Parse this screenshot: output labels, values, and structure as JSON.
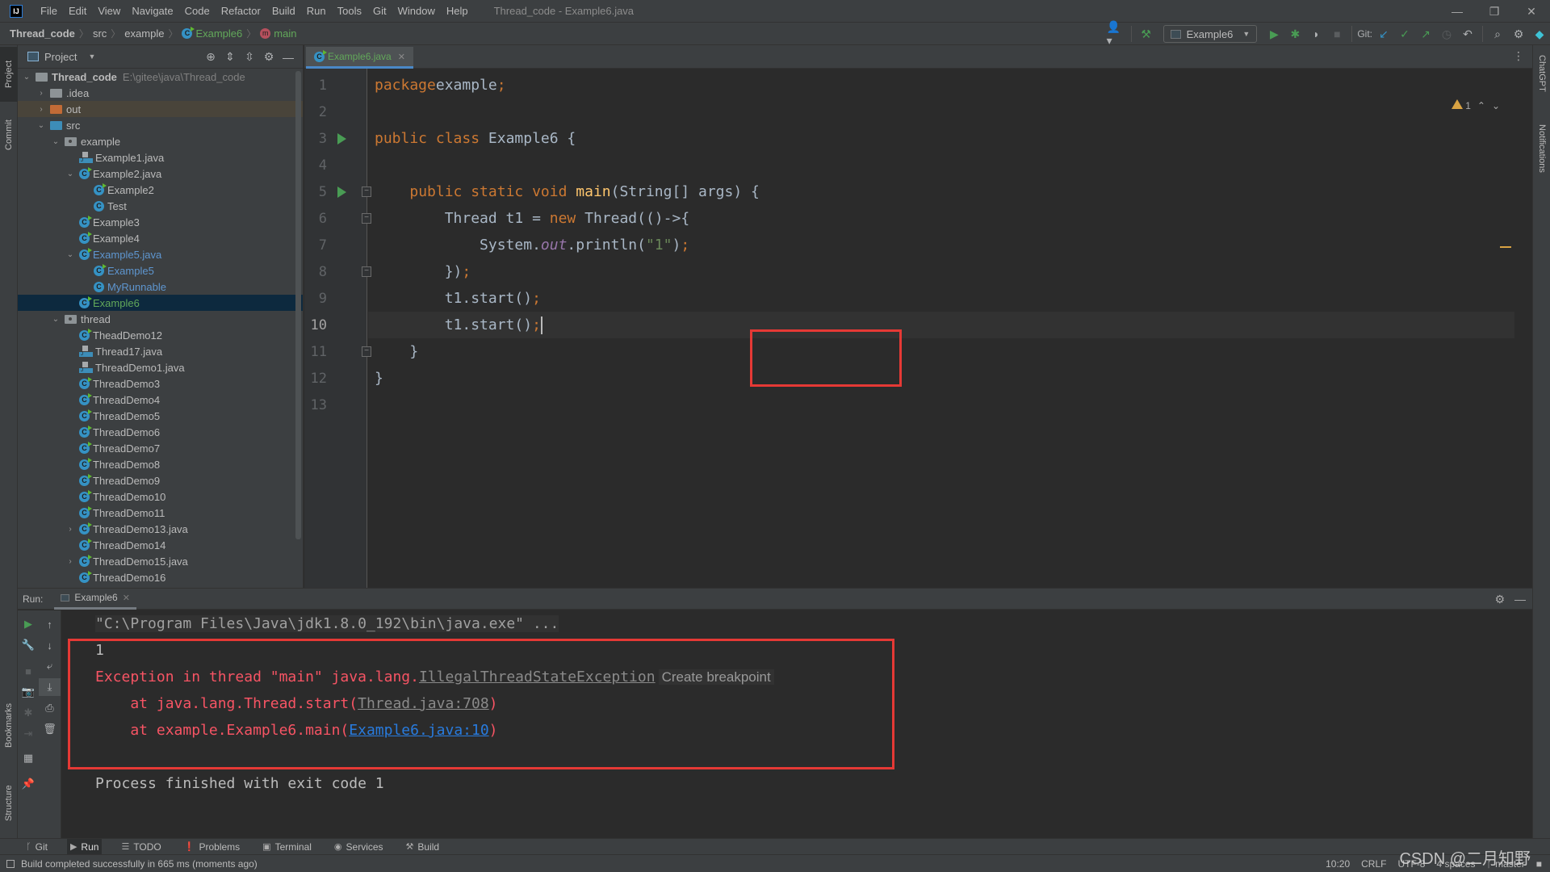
{
  "window": {
    "title": "Thread_code - Example6.java",
    "logo": "IJ",
    "controls": [
      "minimize",
      "restore",
      "close"
    ]
  },
  "menu": [
    "File",
    "Edit",
    "View",
    "Navigate",
    "Code",
    "Refactor",
    "Build",
    "Run",
    "Tools",
    "Git",
    "Window",
    "Help"
  ],
  "breadcrumb": [
    "Thread_code",
    "src",
    "example",
    "Example6",
    "main"
  ],
  "toolbar": {
    "run_config": "Example6",
    "git_label": "Git:"
  },
  "left_stripe": {
    "project": "Project",
    "commit": "Commit",
    "bookmarks": "Bookmarks",
    "structure": "Structure"
  },
  "right_stripe": {
    "chatgpt": "ChatGPT",
    "notifications": "Notifications"
  },
  "project": {
    "title": "Project",
    "root_name": "Thread_code",
    "root_path": "E:\\gitee\\java\\Thread_code",
    "tree": [
      {
        "label": ".idea",
        "kind": "folder",
        "depth": 1,
        "arrow": "right"
      },
      {
        "label": "out",
        "kind": "folder-orange",
        "depth": 1,
        "arrow": "right"
      },
      {
        "label": "src",
        "kind": "folder-blue",
        "depth": 1,
        "arrow": "down"
      },
      {
        "label": "example",
        "kind": "package",
        "depth": 2,
        "arrow": "down"
      },
      {
        "label": "Example1.java",
        "kind": "java-file",
        "depth": 3
      },
      {
        "label": "Example2.java",
        "kind": "class-run",
        "depth": 3,
        "arrow": "down"
      },
      {
        "label": "Example2",
        "kind": "class-run",
        "depth": 4
      },
      {
        "label": "Test",
        "kind": "class",
        "depth": 4
      },
      {
        "label": "Example3",
        "kind": "class-run",
        "depth": 3
      },
      {
        "label": "Example4",
        "kind": "class-run",
        "depth": 3
      },
      {
        "label": "Example5.java",
        "kind": "class-run",
        "depth": 3,
        "arrow": "down",
        "color": "blue"
      },
      {
        "label": "Example5",
        "kind": "class-run",
        "depth": 4,
        "color": "blue"
      },
      {
        "label": "MyRunnable",
        "kind": "class",
        "depth": 4,
        "color": "blue"
      },
      {
        "label": "Example6",
        "kind": "class-run",
        "depth": 3,
        "color": "green",
        "selected": true
      },
      {
        "label": "thread",
        "kind": "package",
        "depth": 2,
        "arrow": "down"
      },
      {
        "label": "TheadDemo12",
        "kind": "class-run",
        "depth": 3
      },
      {
        "label": "Thread17.java",
        "kind": "java-file",
        "depth": 3
      },
      {
        "label": "ThreadDemo1.java",
        "kind": "java-file",
        "depth": 3
      },
      {
        "label": "ThreadDemo3",
        "kind": "class-run",
        "depth": 3
      },
      {
        "label": "ThreadDemo4",
        "kind": "class-run",
        "depth": 3
      },
      {
        "label": "ThreadDemo5",
        "kind": "class-run",
        "depth": 3
      },
      {
        "label": "ThreadDemo6",
        "kind": "class-run",
        "depth": 3
      },
      {
        "label": "ThreadDemo7",
        "kind": "class-run",
        "depth": 3
      },
      {
        "label": "ThreadDemo8",
        "kind": "class-run",
        "depth": 3
      },
      {
        "label": "ThreadDemo9",
        "kind": "class-run",
        "depth": 3
      },
      {
        "label": "ThreadDemo10",
        "kind": "class-run",
        "depth": 3
      },
      {
        "label": "ThreadDemo11",
        "kind": "class-run",
        "depth": 3
      },
      {
        "label": "ThreadDemo13.java",
        "kind": "class-run",
        "depth": 3,
        "arrow": "right"
      },
      {
        "label": "ThreadDemo14",
        "kind": "class-run",
        "depth": 3
      },
      {
        "label": "ThreadDemo15.java",
        "kind": "class-run",
        "depth": 3,
        "arrow": "right"
      },
      {
        "label": "ThreadDemo16",
        "kind": "class-run",
        "depth": 3
      }
    ]
  },
  "editor": {
    "tab": "Example6.java",
    "warnings": "1",
    "current_line": 10,
    "lines": [
      {
        "n": "1",
        "tokens": [
          [
            "kw",
            "package"
          ],
          [
            "",
            "example"
          ],
          [
            "kw",
            ";"
          ]
        ]
      },
      {
        "n": "2",
        "tokens": []
      },
      {
        "n": "3",
        "run": true,
        "tokens": [
          [
            "kw",
            "public class "
          ],
          [
            "",
            "Example6 {"
          ]
        ]
      },
      {
        "n": "4",
        "tokens": []
      },
      {
        "n": "5",
        "run": true,
        "fold": "open",
        "tokens": [
          [
            "",
            "    "
          ],
          [
            "kw",
            "public static void "
          ],
          [
            "fn",
            "main"
          ],
          [
            "",
            "(String[] args) {"
          ]
        ]
      },
      {
        "n": "6",
        "fold": "open",
        "tokens": [
          [
            "",
            "        Thread t1 = "
          ],
          [
            "kw",
            "new "
          ],
          [
            "",
            "Thread(()->{"
          ]
        ]
      },
      {
        "n": "7",
        "tokens": [
          [
            "",
            "            System."
          ],
          [
            "st",
            "out"
          ],
          [
            "",
            ".println("
          ],
          [
            "str",
            "\"1\""
          ],
          [
            "",
            ")"
          ],
          [
            "kw",
            ";"
          ]
        ]
      },
      {
        "n": "8",
        "fold": "close",
        "tokens": [
          [
            "",
            "        })"
          ],
          [
            "kw",
            ";"
          ]
        ]
      },
      {
        "n": "9",
        "tokens": [
          [
            "",
            "        t1.start()"
          ],
          [
            "kw",
            ";"
          ]
        ]
      },
      {
        "n": "10",
        "tokens": [
          [
            "",
            "        t1.start()"
          ],
          [
            "kw",
            ";"
          ]
        ],
        "caret": true
      },
      {
        "n": "11",
        "fold": "close",
        "tokens": [
          [
            "",
            "    }"
          ]
        ]
      },
      {
        "n": "12",
        "tokens": [
          [
            "",
            "}"
          ]
        ]
      },
      {
        "n": "13",
        "tokens": []
      }
    ]
  },
  "run": {
    "label": "Run:",
    "tab": "Example6",
    "command": "\"C:\\Program Files\\Java\\jdk1.8.0_192\\bin\\java.exe\" ...",
    "output_line": "1",
    "exception_prefix": "Exception in thread \"main\" java.lang.",
    "exception_class": "IllegalThreadStateException",
    "breakpoint_hint": "Create breakpoint",
    "stack": [
      {
        "prefix": "    at java.lang.Thread.start(",
        "link": "Thread.java:708",
        "link_style": "gray",
        "suffix": ")"
      },
      {
        "prefix": "    at example.Example6.main(",
        "link": "Example6.java:10",
        "link_style": "blue",
        "suffix": ")"
      }
    ],
    "exit_message": "Process finished with exit code 1"
  },
  "tool_tabs": [
    {
      "label": "Git",
      "icon": "git-branch-icon",
      "glyph": "ᚴ"
    },
    {
      "label": "Run",
      "icon": "run-icon",
      "glyph": "▶",
      "active": true
    },
    {
      "label": "TODO",
      "icon": "list-icon",
      "glyph": "☰"
    },
    {
      "label": "Problems",
      "icon": "problems-icon",
      "glyph": "❗"
    },
    {
      "label": "Terminal",
      "icon": "terminal-icon",
      "glyph": "▣"
    },
    {
      "label": "Services",
      "icon": "services-icon",
      "glyph": "◉"
    },
    {
      "label": "Build",
      "icon": "hammer-icon",
      "glyph": "⚒"
    }
  ],
  "status": {
    "message": "Build completed successfully in 665 ms (moments ago)",
    "position": "10:20",
    "line_sep": "CRLF",
    "encoding": "UTF-8",
    "indent": "4 spaces",
    "branch": "master"
  },
  "watermark": "CSDN @二月知野",
  "colors": {
    "accent": "#4a88c7",
    "run_green": "#499c54",
    "error_red": "#f75464",
    "highlight_box": "#e53935",
    "keyword": "#cc7832",
    "function": "#ffc66d",
    "string": "#6a8759"
  }
}
